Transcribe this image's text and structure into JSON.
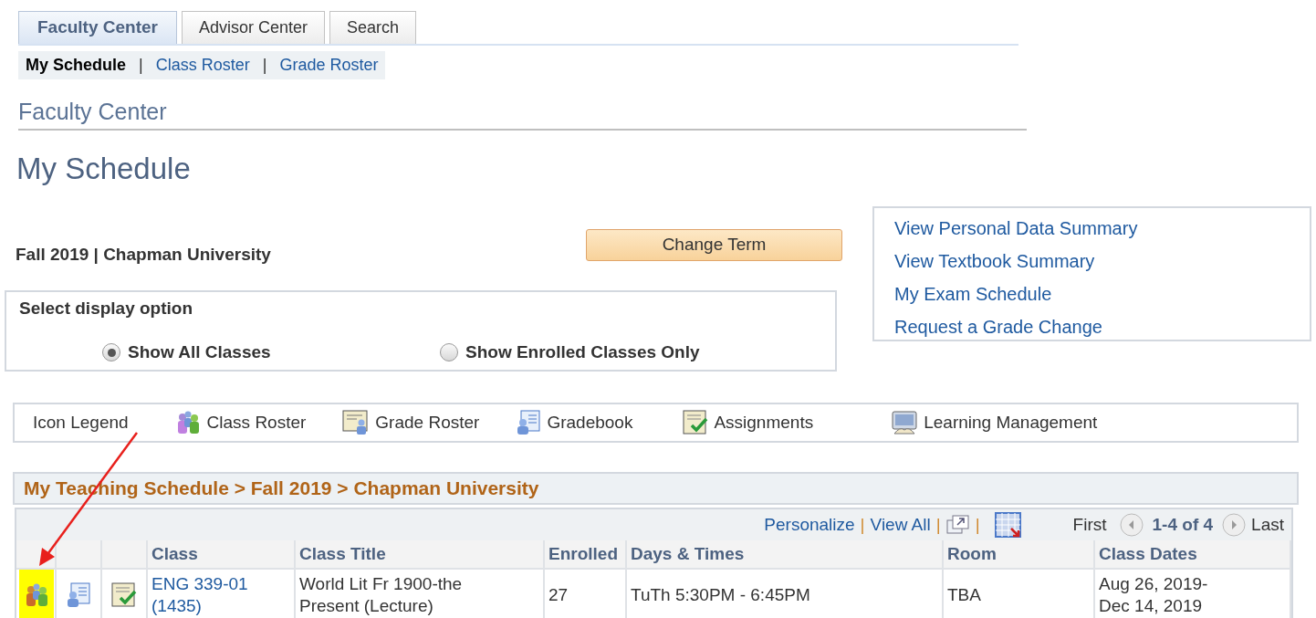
{
  "tabs": [
    {
      "label": "Faculty Center",
      "selected": true
    },
    {
      "label": "Advisor Center",
      "selected": false
    },
    {
      "label": "Search",
      "selected": false
    }
  ],
  "subnav": [
    {
      "label": "My Schedule",
      "selected": true
    },
    {
      "label": "Class Roster",
      "selected": false
    },
    {
      "label": "Grade Roster",
      "selected": false
    }
  ],
  "subnav_separator": "|",
  "section_title": "Faculty Center",
  "page_title": "My Schedule",
  "term": "Fall 2019 | Chapman University",
  "change_term_button": "Change Term",
  "links": [
    "View Personal Data Summary",
    "View Textbook Summary",
    "My Exam Schedule",
    "Request a Grade Change"
  ],
  "display_option": {
    "label": "Select display option",
    "options": [
      {
        "label": "Show All Classes",
        "selected": true
      },
      {
        "label": "Show Enrolled Classes Only",
        "selected": false
      }
    ]
  },
  "icon_legend": {
    "label": "Icon Legend",
    "items": [
      {
        "kind": "roster",
        "label": "Class Roster"
      },
      {
        "kind": "grade",
        "label": "Grade Roster"
      },
      {
        "kind": "gradebook",
        "label": "Gradebook"
      },
      {
        "kind": "assign",
        "label": "Assignments"
      },
      {
        "kind": "lms",
        "label": "Learning Management"
      }
    ]
  },
  "schedule": {
    "title": "My Teaching Schedule > Fall 2019 > Chapman University",
    "toolbar": {
      "personalize": "Personalize",
      "view_all": "View All",
      "separator": "|",
      "first": "First",
      "range": "1-4 of 4",
      "last": "Last"
    },
    "columns": [
      "Class",
      "Class Title",
      "Enrolled",
      "Days & Times",
      "Room",
      "Class Dates"
    ],
    "rows": [
      {
        "roster_highlighted": true,
        "class": [
          "ENG 339-01",
          "(1435)"
        ],
        "title": [
          "World Lit Fr 1900-the",
          "Present (Lecture)"
        ],
        "enrolled": "27",
        "days_times": "TuTh 5:30PM - 6:45PM",
        "room": "TBA",
        "dates": [
          "Aug 26, 2019-",
          "Dec 14, 2019"
        ]
      }
    ]
  }
}
